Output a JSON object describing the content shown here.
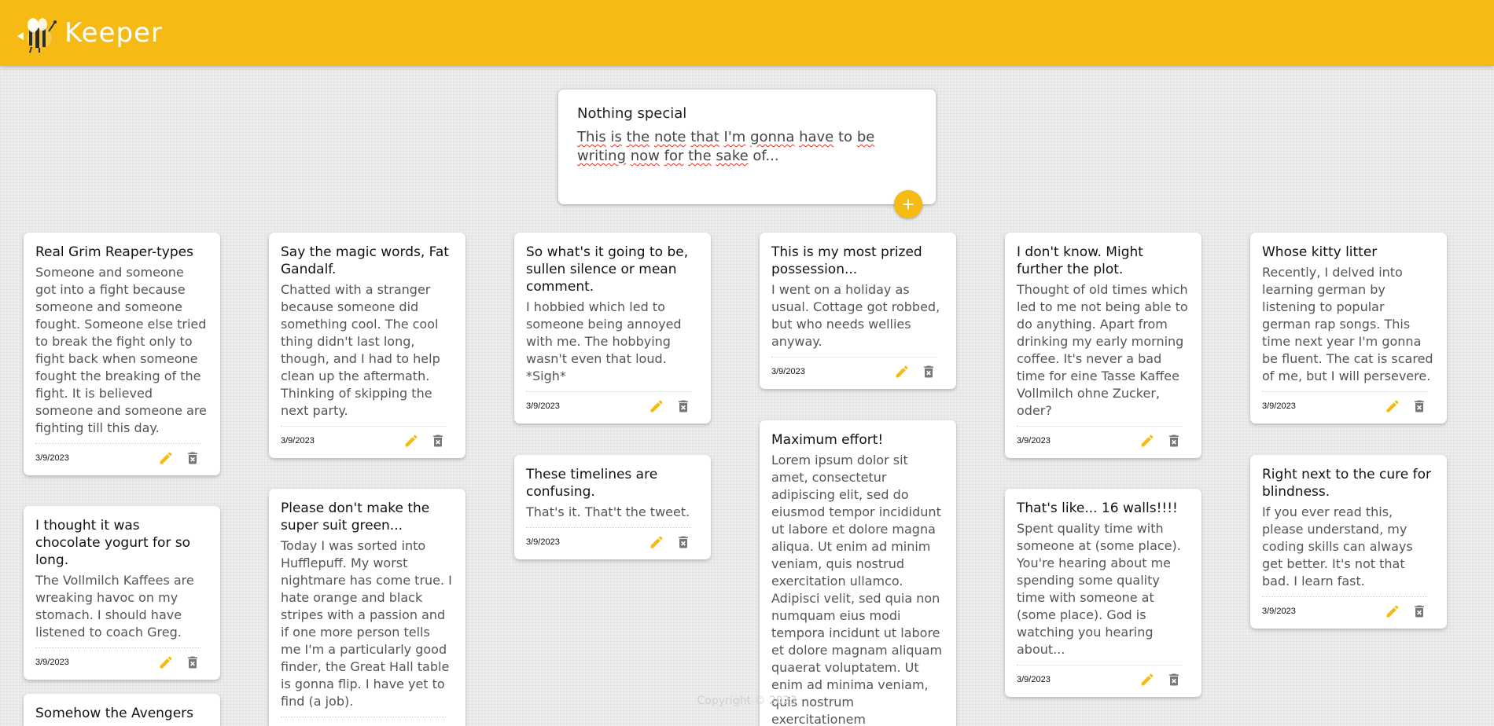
{
  "app": {
    "name": "Keeper"
  },
  "colors": {
    "accent": "#f5ba13",
    "delete": "#777777"
  },
  "create": {
    "title": "Nothing special",
    "words": [
      "This",
      "is",
      "the",
      "note",
      "that",
      "I'm",
      "gonna",
      "have",
      "to",
      "be",
      "writing",
      "now",
      "for",
      "the",
      "sake",
      "of..."
    ],
    "add_icon": "+"
  },
  "notes": [
    {
      "title": "Real Grim Reaper-types",
      "content": "Someone and someone got into a fight because someone and someone fought. Someone else tried to break the fight only to fight back when someone fought the breaking of the fight. It is believed someone and someone are fighting till this day.",
      "date": "3/9/2023"
    },
    {
      "title": "I thought it was chocolate yogurt for so long.",
      "content": "The Vollmilch Kaffees are wreaking havoc on my stomach. I should have listened to coach Greg.",
      "date": "3/9/2023"
    },
    {
      "title": "Somehow the Avengers",
      "content": "",
      "date": ""
    },
    {
      "title": "Say the magic words, Fat Gandalf.",
      "content": "Chatted with a stranger because someone did something cool. The cool thing didn't last long, though, and I had to help clean up the aftermath. Thinking of skipping the next party.",
      "date": "3/9/2023"
    },
    {
      "title": "Please don't make the super suit green...",
      "content": "Today I was sorted into Hufflepuff. My worst nightmare has come true. I hate orange and black stripes with a passion and if one more person tells me I'm a particularly good finder, the Great Hall table is gonna flip. I have yet to find (a job).",
      "date": ""
    },
    {
      "title": "So what's it going to be, sullen silence or mean comment.",
      "content": "I hobbied which led to someone being annoyed with me. The hobbying wasn't even that loud. *Sigh*",
      "date": "3/9/2023"
    },
    {
      "title": "These timelines are confusing.",
      "content": "That's it. That't the tweet.",
      "date": "3/9/2023"
    },
    {
      "title": "This is my most prized possession...",
      "content": "I went on a holiday as usual. Cottage got robbed, but who needs wellies anyway.",
      "date": "3/9/2023"
    },
    {
      "title": "Maximum effort!",
      "content": "Lorem ipsum dolor sit amet, consectetur adipiscing elit, sed do eiusmod tempor incididunt ut labore et dolore magna aliqua. Ut enim ad minim veniam, quis nostrud exercitation ullamco. Adipisci velit, sed quia non numquam eius modi tempora incidunt ut labore et dolore magnam aliquam quaerat voluptatem. Ut enim ad minima veniam, quis nostrum exercitationem",
      "date": ""
    },
    {
      "title": "I don't know. Might further the plot.",
      "content": "Thought of old times which led to me not being able to do anything. Apart from drinking my early morning coffee. It's never a bad time for eine Tasse Kaffee Vollmilch ohne Zucker, oder?",
      "date": "3/9/2023"
    },
    {
      "title": "That's like... 16 walls!!!!",
      "content": "Spent quality time with someone at (some place). You're hearing about me spending some quality time with someone at (some place). God is watching you hearing about...",
      "date": "3/9/2023"
    },
    {
      "title": "Whose kitty litter",
      "content": "Recently, I delved into learning german by listening to popular german rap songs. This time next year I'm gonna be fluent. The cat is scared of me, but I will persevere.",
      "date": "3/9/2023"
    },
    {
      "title": "Right next to the cure for blindness.",
      "content": "If you ever read this, please understand, my coding skills can always get better. It's not that bad. I learn fast.",
      "date": "3/9/2023"
    }
  ],
  "footer": {
    "text": "Copyright © 2023"
  }
}
